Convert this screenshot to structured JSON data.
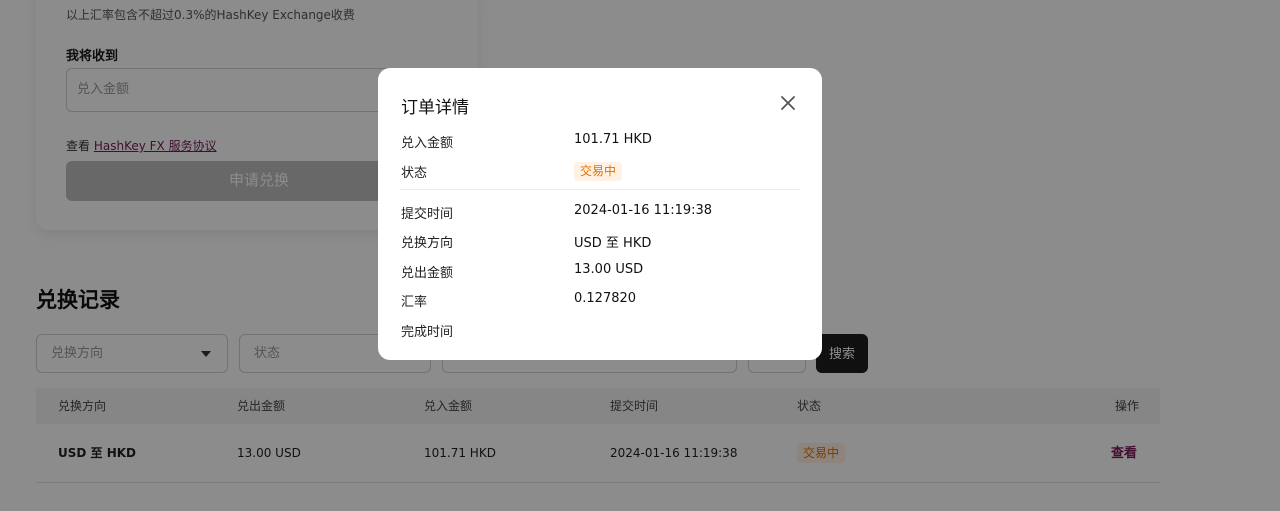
{
  "form": {
    "fee_note": "以上汇率包含不超过0.3%的HashKey Exchange收费",
    "receive_label": "我将收到",
    "receive_placeholder": "兑入金额",
    "agreement_prefix": "查看",
    "agreement_link": "HashKey FX 服务协议",
    "apply_button": "申请兑换"
  },
  "records": {
    "title": "兑换记录",
    "filters": {
      "direction_placeholder": "兑换方向",
      "status_placeholder": "状态",
      "date_placeholder": "",
      "extra_placeholder": ""
    },
    "search_button": "搜索",
    "columns": [
      "兑换方向",
      "兑出金额",
      "兑入金额",
      "提交时间",
      "状态",
      "操作"
    ],
    "rows": [
      {
        "direction": "USD 至 HKD",
        "out_amount": "13.00 USD",
        "in_amount": "101.71 HKD",
        "submit_time": "2024-01-16 11:19:38",
        "status": "交易中",
        "action": "查看"
      }
    ]
  },
  "modal": {
    "title": "订单详情",
    "close_icon": "close-icon",
    "fields": [
      {
        "label": "兑入金额",
        "value": "101.71  HKD"
      },
      {
        "label": "状态",
        "value": "交易中"
      },
      {
        "label": "提交时间",
        "value": "2024-01-16 11:19:38"
      },
      {
        "label": "兑换方向",
        "value": "USD 至 HKD"
      },
      {
        "label": "兑出金额",
        "value": "13.00  USD"
      },
      {
        "label": "汇率",
        "value": "0.127820"
      },
      {
        "label": "完成时间",
        "value": ""
      }
    ]
  },
  "colors": {
    "accent_link": "#7a1b5c",
    "status_text": "#e07000",
    "status_bg": "#fff1e3",
    "search_button_bg": "#1e1e1e"
  }
}
